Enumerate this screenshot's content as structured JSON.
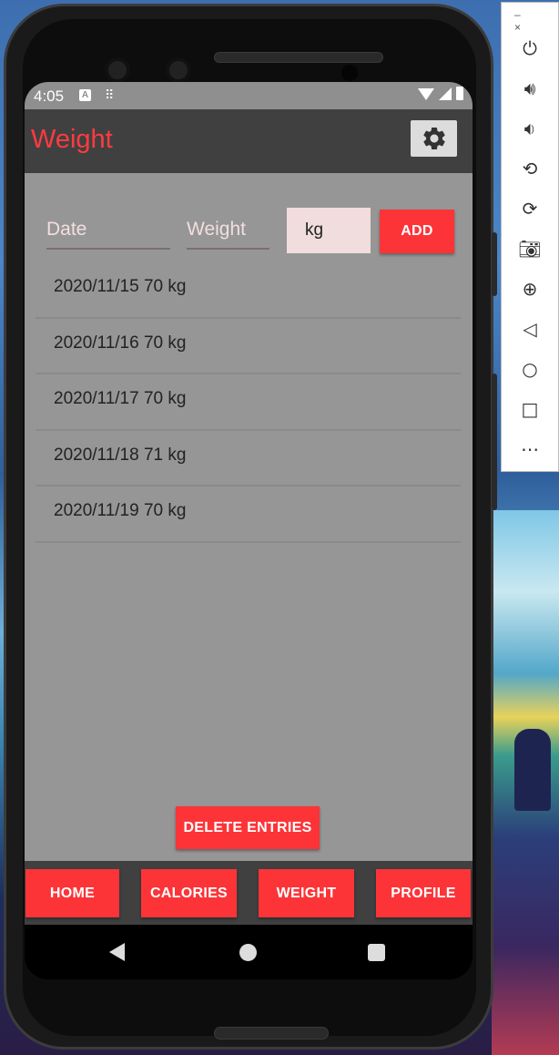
{
  "status_bar": {
    "time": "4:05",
    "notification_letter": "A"
  },
  "app_bar": {
    "title": "Weight",
    "settings_icon": "gear-icon"
  },
  "form": {
    "date_placeholder": "Date",
    "weight_placeholder": "Weight",
    "unit": "kg",
    "add_label": "ADD"
  },
  "entries": [
    "2020/11/15 70 kg",
    "2020/11/16 70 kg",
    "2020/11/17 70 kg",
    "2020/11/18 71 kg",
    "2020/11/19 70 kg"
  ],
  "delete_label": "DELETE ENTRIES",
  "bottom_nav": {
    "home": "HOME",
    "calories": "CALORIES",
    "weight": "WEIGHT",
    "profile": "PROFILE"
  },
  "emulator_window": {
    "minimize": "–",
    "close": "×"
  },
  "colors": {
    "accent": "#fc3438",
    "app_bar": "#404040",
    "content_bg": "#969696"
  }
}
